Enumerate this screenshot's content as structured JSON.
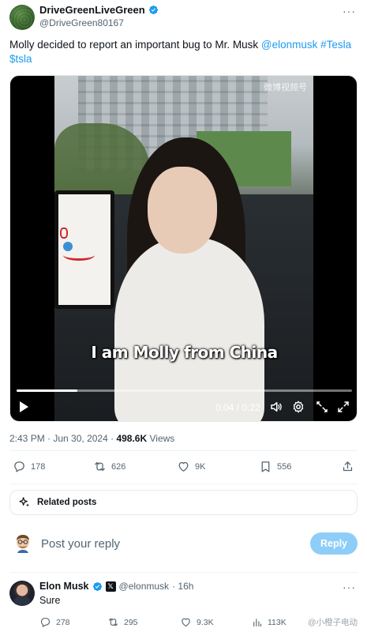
{
  "post": {
    "display_name": "DriveGreenLiveGreen",
    "handle": "@DriveGreen80167",
    "more_label": "···",
    "text_plain": "Molly decided to report an important bug to Mr. Musk ",
    "mention": "@elonmusk",
    "hashtag1": "#Tesla",
    "cashtag": "$tsla",
    "verified_color": "#1d9bf0"
  },
  "video": {
    "watermark": "微博视频号",
    "caption": "I am Molly from China",
    "time": "0:04 / 0:22",
    "progress": 0.18,
    "icons": [
      "play-icon",
      "volume-icon",
      "settings-icon",
      "pip-icon",
      "fullscreen-icon"
    ]
  },
  "meta": {
    "time": "2:43 PM",
    "sep": " · ",
    "date": "Jun 30, 2024",
    "sep2": " · ",
    "views_count": "498.6K",
    "views_label": " Views"
  },
  "actions": {
    "replies": "178",
    "reposts": "626",
    "likes": "9K",
    "bookmarks": "556"
  },
  "related": {
    "label": "Related posts"
  },
  "reply_composer": {
    "placeholder": "Post your reply",
    "button": "Reply",
    "button_color": "#8ecdf8"
  },
  "reply": {
    "name": "Elon Musk",
    "badge": "𝕏",
    "handle": "@elonmusk",
    "time": " · 16h",
    "text": "Sure",
    "more_label": "···",
    "replies": "278",
    "reposts": "295",
    "likes": "9.3K",
    "views": "113K",
    "watermark": "@小橙子电动"
  }
}
